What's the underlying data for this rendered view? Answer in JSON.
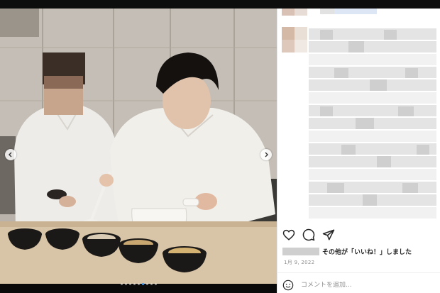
{
  "post": {
    "likes_text": "その他が「いいね！」しました",
    "date": "1月 9, 2022",
    "comment_placeholder": "コメントを追加...",
    "carousel": {
      "slides": 9,
      "active_index": 5
    }
  },
  "icons": {
    "like": "heart-icon",
    "comment": "comment-icon",
    "share": "paper-plane-icon",
    "emoji": "emoji-icon",
    "prev": "chevron-left-icon",
    "next": "chevron-right-icon"
  },
  "colors": {
    "carousel_active_dot": "#3897f0",
    "text": "#262626",
    "secondary_text": "#8e8e8e"
  }
}
